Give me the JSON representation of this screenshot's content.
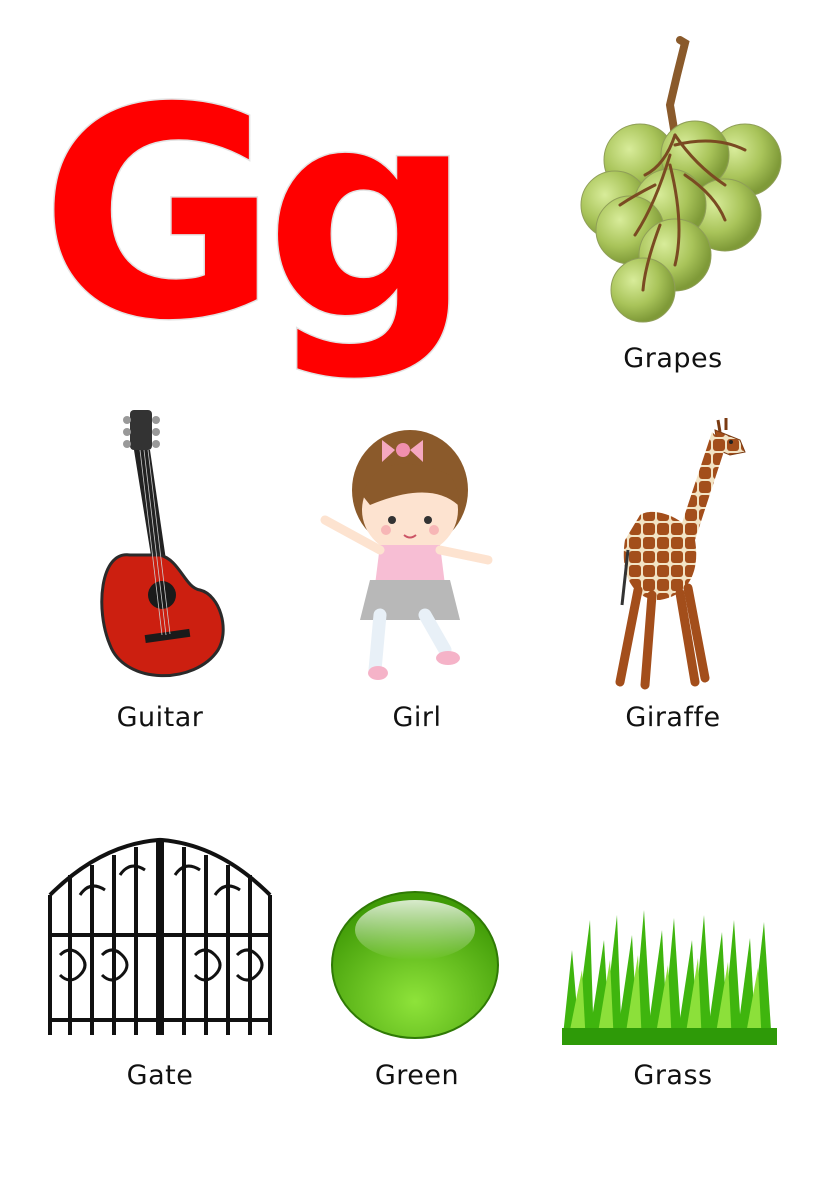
{
  "letters": {
    "upper": "G",
    "lower": "g",
    "color": "#ff0000"
  },
  "items": [
    {
      "label": "Grapes",
      "icon": "grapes-icon"
    },
    {
      "label": "Guitar",
      "icon": "guitar-icon"
    },
    {
      "label": "Girl",
      "icon": "girl-icon"
    },
    {
      "label": "Giraffe",
      "icon": "giraffe-icon"
    },
    {
      "label": "Gate",
      "icon": "gate-icon"
    },
    {
      "label": "Green",
      "icon": "green-circle-icon"
    },
    {
      "label": "Grass",
      "icon": "grass-icon"
    }
  ]
}
